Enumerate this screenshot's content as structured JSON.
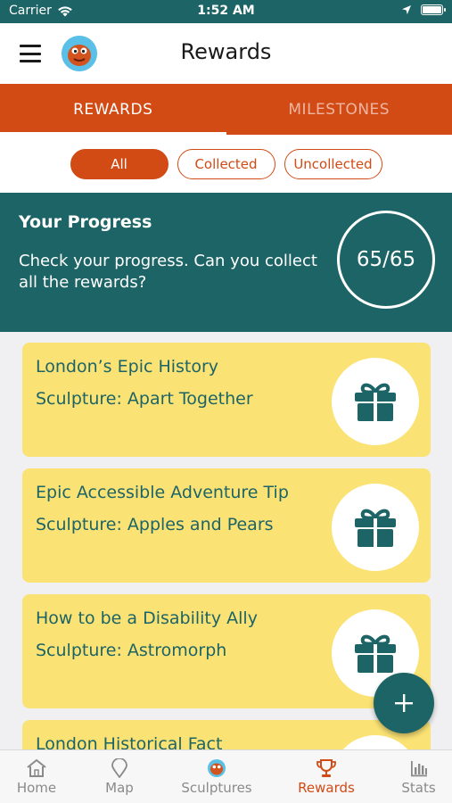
{
  "status_bar": {
    "carrier": "Carrier",
    "time": "1:52 AM"
  },
  "header": {
    "title": "Rewards"
  },
  "tabs": [
    {
      "label": "REWARDS",
      "active": true
    },
    {
      "label": "MILESTONES",
      "active": false
    }
  ],
  "filters": [
    {
      "label": "All",
      "active": true
    },
    {
      "label": "Collected",
      "active": false
    },
    {
      "label": "Uncollected",
      "active": false
    }
  ],
  "progress": {
    "heading": "Your Progress",
    "description": "Check your progress. Can you collect all the rewards?",
    "count": "65/65"
  },
  "rewards": [
    {
      "title": "London’s Epic History",
      "sculpture": "Sculpture: Apart Together"
    },
    {
      "title": "Epic Accessible Adventure Tip",
      "sculpture": "Sculpture: Apples and Pears"
    },
    {
      "title": "How to be a Disability Ally",
      "sculpture": "Sculpture: Astromorph"
    },
    {
      "title": "London Historical Fact",
      "sculpture": ""
    }
  ],
  "bottom_nav": [
    {
      "label": "Home",
      "icon": "home-icon"
    },
    {
      "label": "Map",
      "icon": "map-pin-icon"
    },
    {
      "label": "Sculptures",
      "icon": "sculpture-icon"
    },
    {
      "label": "Rewards",
      "icon": "trophy-icon",
      "active": true
    },
    {
      "label": "Stats",
      "icon": "stats-icon"
    }
  ],
  "colors": {
    "teal": "#1d6466",
    "orange": "#d24a14",
    "card_yellow": "#fbe274",
    "background": "#f0f0f3"
  }
}
